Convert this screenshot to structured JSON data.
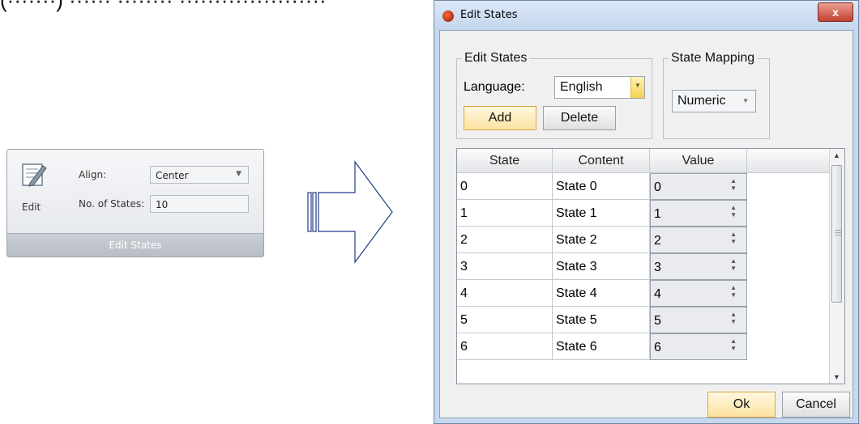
{
  "caption_fragment": "(·······) ······ ········ ·····················",
  "ribbon": {
    "edit_label": "Edit",
    "align_label": "Align:",
    "align_value": "Center",
    "states_label": "No. of States:",
    "states_value": "10",
    "footer_label": "Edit States",
    "icons": {
      "edit": "edit-pencil-icon",
      "dropdown": "chevron-down-icon"
    }
  },
  "dialog": {
    "title": "Edit States",
    "close_label": "x",
    "edit_group": {
      "title": "Edit States",
      "language_label": "Language:",
      "language_value": "English",
      "add_label": "Add",
      "delete_label": "Delete"
    },
    "mapping_group": {
      "title": "State Mapping",
      "mapping_value": "Numeric"
    },
    "grid": {
      "columns": [
        "State",
        "Content",
        "Value"
      ],
      "rows": [
        {
          "state": "0",
          "content": "State 0",
          "value": "0"
        },
        {
          "state": "1",
          "content": "State 1",
          "value": "1"
        },
        {
          "state": "2",
          "content": "State 2",
          "value": "2"
        },
        {
          "state": "3",
          "content": "State 3",
          "value": "3"
        },
        {
          "state": "4",
          "content": "State 4",
          "value": "4"
        },
        {
          "state": "5",
          "content": "State 5",
          "value": "5"
        },
        {
          "state": "6",
          "content": "State 6",
          "value": "6"
        }
      ]
    },
    "ok_label": "Ok",
    "cancel_label": "Cancel"
  },
  "colors": {
    "dialog_frame": "#c6d8ee",
    "ok_button": "#fbe2a0",
    "combo_drop": "#f7d04f",
    "close_button": "#c4402f"
  }
}
